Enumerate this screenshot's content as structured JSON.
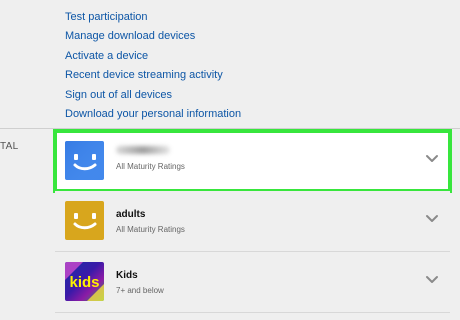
{
  "links": [
    "Test participation",
    "Manage download devices",
    "Activate a device",
    "Recent device streaming activity",
    "Sign out of all devices",
    "Download your personal information"
  ],
  "section_label": "TAL",
  "profiles": [
    {
      "name": "",
      "subtitle": "All Maturity Ratings",
      "avatar_icon": "blue-smiley-avatar-icon",
      "selected": true
    },
    {
      "name": "adults",
      "subtitle": "All Maturity Ratings",
      "avatar_icon": "yellow-smiley-avatar-icon",
      "selected": false
    },
    {
      "name": "Kids",
      "subtitle": "7+ and below",
      "avatar_icon": "kids-avatar-icon",
      "selected": false
    }
  ],
  "colors": {
    "link": "#0d56a6",
    "selection_highlight": "#38e63d",
    "background": "#efefef",
    "selected_background": "#ffffff"
  }
}
